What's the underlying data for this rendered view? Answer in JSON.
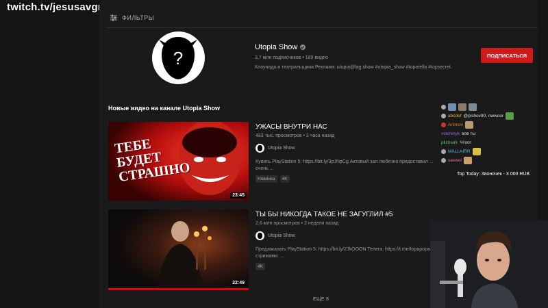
{
  "watermark": "twitch.tv/jesusavgn",
  "filters_label": "ФИЛЬТРЫ",
  "channel": {
    "name": "Utopia Show",
    "stats": "3,7 млн подписчиков • 189 видео",
    "description": "Клоунада и театральщина Реклама: utopia@lag.show #utopia_show #topatella #topsecret.",
    "subscribe_label": "ПОДПИСАТЬСЯ"
  },
  "section_title": "Новые видео на канале Utopia Show",
  "videos": [
    {
      "title": "УЖАСЫ ВНУТРИ НАС",
      "meta": "483 тыс. просмотров • 3 часа назад",
      "channel": "Utopia Show",
      "description_line1": "Купить PlayStation 5: https://bit.ly/3pJNpCg Актовый зал любезно предоставил ...",
      "description_line2": "очень ...",
      "badges": [
        "Новинка",
        "4K"
      ],
      "duration": "23:45",
      "thumb_text": [
        "ТЕБЕ",
        "БУДЕТ",
        "СТРАШНО"
      ]
    },
    {
      "title": "ТЫ БЫ НИКОГДА ТАКОЕ НЕ ЗАГУГЛИЛ #5",
      "meta": "2,6 млн просмотров • 2 недели назад",
      "channel": "Utopia Show",
      "description_line1": "Предзаказать PlayStation 5: https://bit.ly/2JkOOON Телега: https://t.me/topapopa Я сейчас",
      "description_line2": "стримами: ...",
      "badges": [
        "4K"
      ],
      "duration": "22:49"
    }
  ],
  "more_label": "ЕЩЕ 8",
  "chat": [
    {
      "user": "",
      "text": "",
      "color": "#7b7bd6"
    },
    {
      "user": "abcdef",
      "text": "@pishov90, nwwoor",
      "color": "#e0b43c"
    },
    {
      "user": "Artimov",
      "text": "",
      "color": "#e07b2a"
    },
    {
      "user": "vsezenyk",
      "text": "вов ты",
      "color": "#9a6ee6"
    },
    {
      "user": "plizmark",
      "text": "Чтоот",
      "color": "#6ac36a"
    },
    {
      "user": "MALLAIRR",
      "text": "",
      "color": "#4bb8e6"
    },
    {
      "user": "saxwol",
      "text": "",
      "color": "#e86a9a"
    }
  ],
  "top_today": "Top Today: Звоночек - 3 000 RUB"
}
